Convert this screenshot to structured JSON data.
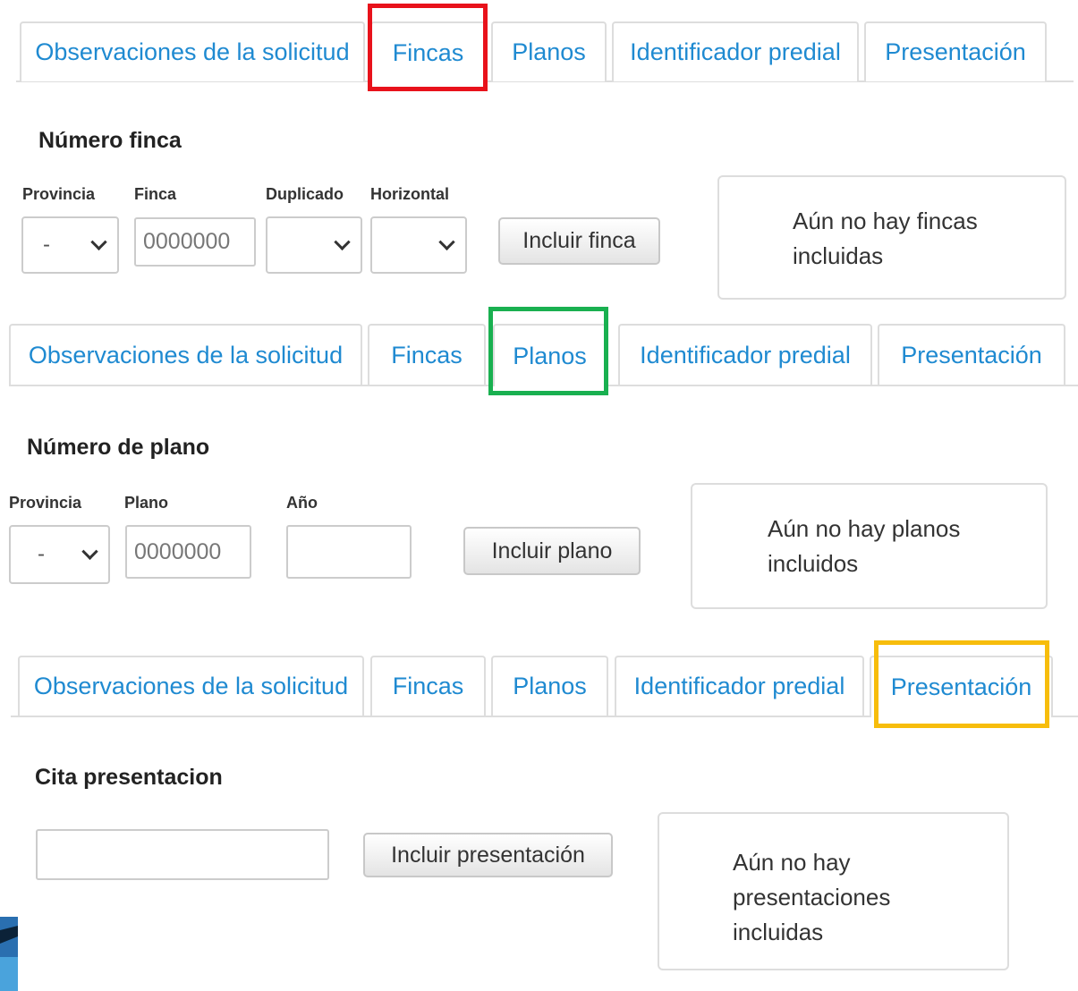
{
  "colors": {
    "tab_text": "#1f8ad1",
    "highlight_fincas": "#e8121b",
    "highlight_planos": "#19b050",
    "highlight_presentacion": "#f7bd0c"
  },
  "tabs": {
    "observaciones": "Observaciones de la solicitud",
    "fincas": "Fincas",
    "planos": "Planos",
    "identificador": "Identificador predial",
    "presentacion": "Presentación"
  },
  "fincas_panel": {
    "heading": "Número finca",
    "provincia_label": "Provincia",
    "provincia_value": "-",
    "finca_label": "Finca",
    "finca_placeholder": "0000000",
    "duplicado_label": "Duplicado",
    "horizontal_label": "Horizontal",
    "button": "Incluir finca",
    "empty_line1": "Aún no hay fincas",
    "empty_line2": "incluidas"
  },
  "planos_panel": {
    "heading": "Número de plano",
    "provincia_label": "Provincia",
    "provincia_value": "-",
    "plano_label": "Plano",
    "plano_placeholder": "0000000",
    "ano_label": "Año",
    "button": "Incluir plano",
    "empty_line1": "Aún no hay planos",
    "empty_line2": "incluidos"
  },
  "presentacion_panel": {
    "heading": "Cita presentacion",
    "button": "Incluir presentación",
    "empty_line1": "Aún no hay",
    "empty_line2": "presentaciones",
    "empty_line3": "incluidas"
  }
}
